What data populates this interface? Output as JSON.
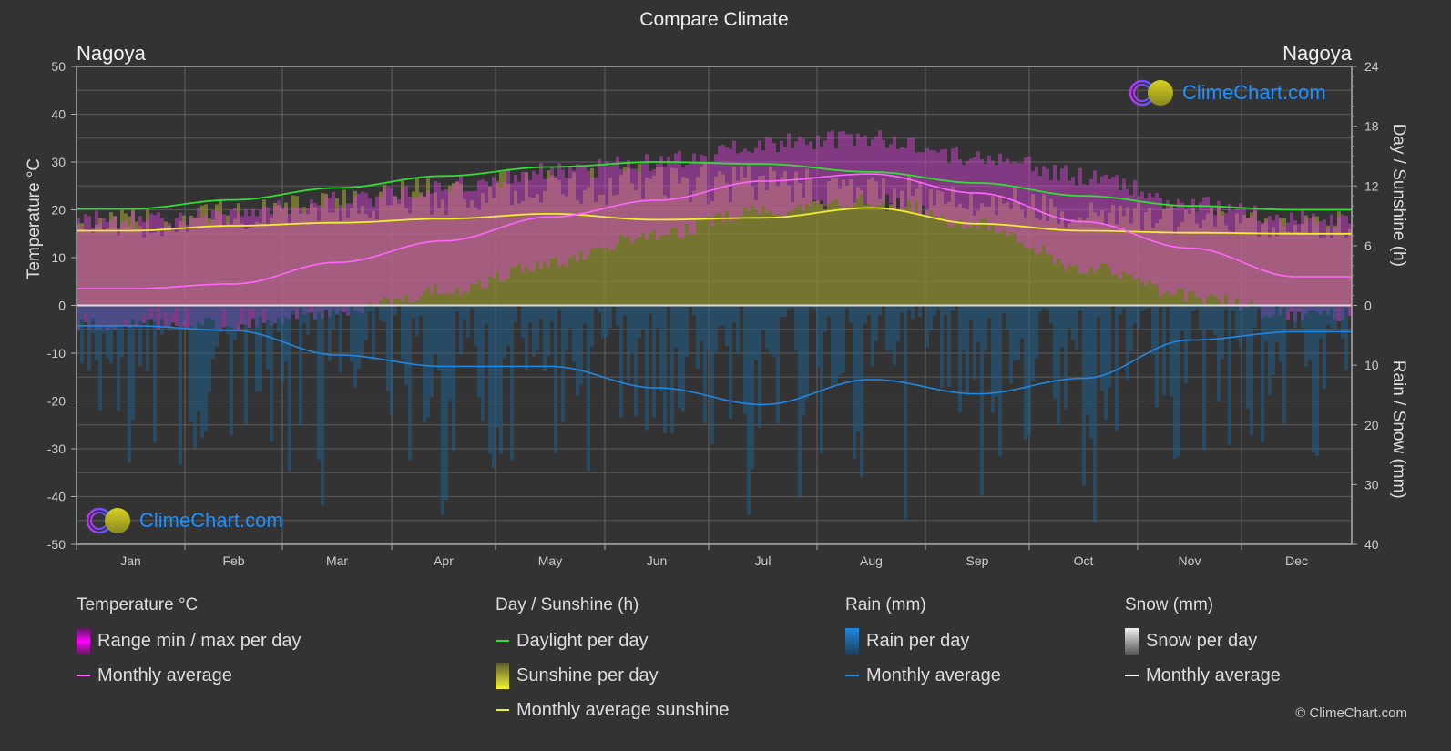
{
  "title": "Compare Climate",
  "city_left": "Nagoya",
  "city_right": "Nagoya",
  "watermark": "ClimeChart.com",
  "copyright": "© ClimeChart.com",
  "colors": {
    "background": "#333333",
    "temp_avg": "#ff66ff",
    "temp_range": "#e040e0",
    "daylight": "#33dd33",
    "sunshine_avg": "#eeee33",
    "sunshine_fill": "#8c8c32",
    "rain_avg": "#1e88e5",
    "rain_fill": "#1f5c8a",
    "snow_avg": "#ffffff",
    "logo_text": "#1e90ff"
  },
  "legend": {
    "temperature": {
      "heading": "Temperature °C",
      "range_label": "Range min / max per day",
      "avg_label": "Monthly average"
    },
    "sunshine": {
      "heading": "Day / Sunshine (h)",
      "daylight_label": "Daylight per day",
      "sunshine_label": "Sunshine per day",
      "avg_label": "Monthly average sunshine"
    },
    "rain": {
      "heading": "Rain (mm)",
      "per_day_label": "Rain per day",
      "avg_label": "Monthly average"
    },
    "snow": {
      "heading": "Snow (mm)",
      "per_day_label": "Snow per day",
      "avg_label": "Monthly average"
    }
  },
  "chart_data": {
    "type": "line",
    "title": "Compare Climate",
    "categories": [
      "Jan",
      "Feb",
      "Mar",
      "Apr",
      "May",
      "Jun",
      "Jul",
      "Aug",
      "Sep",
      "Oct",
      "Nov",
      "Dec"
    ],
    "left_axis": {
      "label": "Temperature °C",
      "range": [
        -50,
        50
      ],
      "ticks": [
        50,
        40,
        30,
        20,
        10,
        0,
        -10,
        -20,
        -30,
        -40,
        -50
      ]
    },
    "right_axis_top": {
      "label": "Day / Sunshine (h)",
      "range": [
        0,
        24
      ],
      "ticks": [
        24,
        18,
        12,
        6,
        0
      ]
    },
    "right_axis_bottom": {
      "label": "Rain / Snow (mm)",
      "range": [
        0,
        40
      ],
      "ticks": [
        0,
        10,
        20,
        30,
        40
      ]
    },
    "grid": true,
    "legend_position": "bottom",
    "series": [
      {
        "name": "Temperature monthly average",
        "unit": "°C",
        "axis": "left",
        "values": [
          3.5,
          4.5,
          9.0,
          13.5,
          18.5,
          22.0,
          26.0,
          27.5,
          23.5,
          17.5,
          12.0,
          6.0
        ]
      },
      {
        "name": "Temperature daily max (approx. upper range)",
        "unit": "°C",
        "axis": "left",
        "values": [
          18,
          19,
          22,
          25,
          28,
          30,
          34,
          35,
          31,
          27,
          21,
          18
        ]
      },
      {
        "name": "Temperature daily min (approx. lower range)",
        "unit": "°C",
        "axis": "left",
        "values": [
          -4,
          -4,
          -1,
          3,
          9,
          15,
          20,
          22,
          17,
          8,
          2,
          -2
        ]
      },
      {
        "name": "Daylight per day",
        "unit": "h",
        "axis": "right_top",
        "values": [
          9.7,
          10.6,
          11.8,
          13.0,
          13.9,
          14.4,
          14.2,
          13.4,
          12.3,
          11.0,
          10.0,
          9.6
        ]
      },
      {
        "name": "Monthly average sunshine",
        "unit": "h",
        "axis": "right_top",
        "values": [
          7.5,
          8.0,
          8.3,
          8.7,
          9.2,
          8.6,
          8.8,
          9.8,
          8.2,
          7.5,
          7.3,
          7.2
        ]
      },
      {
        "name": "Rain monthly average",
        "unit": "mm",
        "axis": "right_bottom",
        "values": [
          3.4,
          4.2,
          8.3,
          10.2,
          10.2,
          13.8,
          16.6,
          12.4,
          14.8,
          12.2,
          5.8,
          4.4
        ]
      }
    ]
  }
}
